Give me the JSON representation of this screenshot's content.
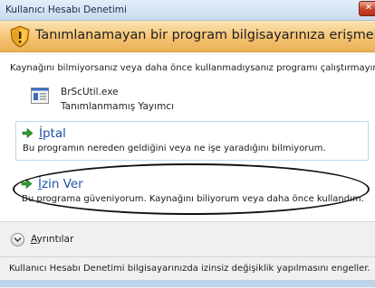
{
  "window": {
    "title": "Kullanıcı Hesabı Denetimi",
    "close_label": "✕"
  },
  "banner": {
    "text": "Tanımlanamayan bir program bilgisayarınıza erişmek istiyor"
  },
  "intro": "Kaynağını bilmiyorsanız veya daha önce kullanmadıysanız programı çalıştırmayın.",
  "program": {
    "name": "BrScUtil.exe",
    "publisher": "Tanımlanmamış Yayımcı",
    "icon": "application-icon"
  },
  "options": {
    "cancel": {
      "title_first": "İ",
      "title_rest": "ptal",
      "description": "Bu programın nereden geldiğini veya ne işe yaradığını bilmiyorum."
    },
    "allow": {
      "title_first": "İ",
      "title_rest": "zin Ver",
      "description": "Bu programa güveniyorum. Kaynağını biliyorum veya daha önce kullandım."
    }
  },
  "details": {
    "label_first": "A",
    "label_rest": "yrıntılar"
  },
  "footer": {
    "text": "Kullanıcı Hesabı Denetimi bilgisayarınızda izinsiz değişiklik yapılmasını engeller."
  },
  "colors": {
    "accent": "#1f51a8",
    "banner": "#f4c06e",
    "arrow": "#2e9b2e"
  }
}
